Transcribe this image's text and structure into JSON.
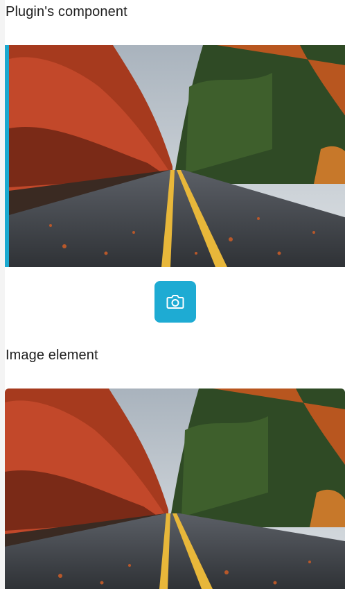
{
  "plugin_section": {
    "title": "Plugin's component",
    "camera_icon": "camera-icon"
  },
  "image_section": {
    "title": "Image element"
  },
  "photo": {
    "description_icon": "autumn-road-photo",
    "accent_color": "#1eabd3"
  }
}
